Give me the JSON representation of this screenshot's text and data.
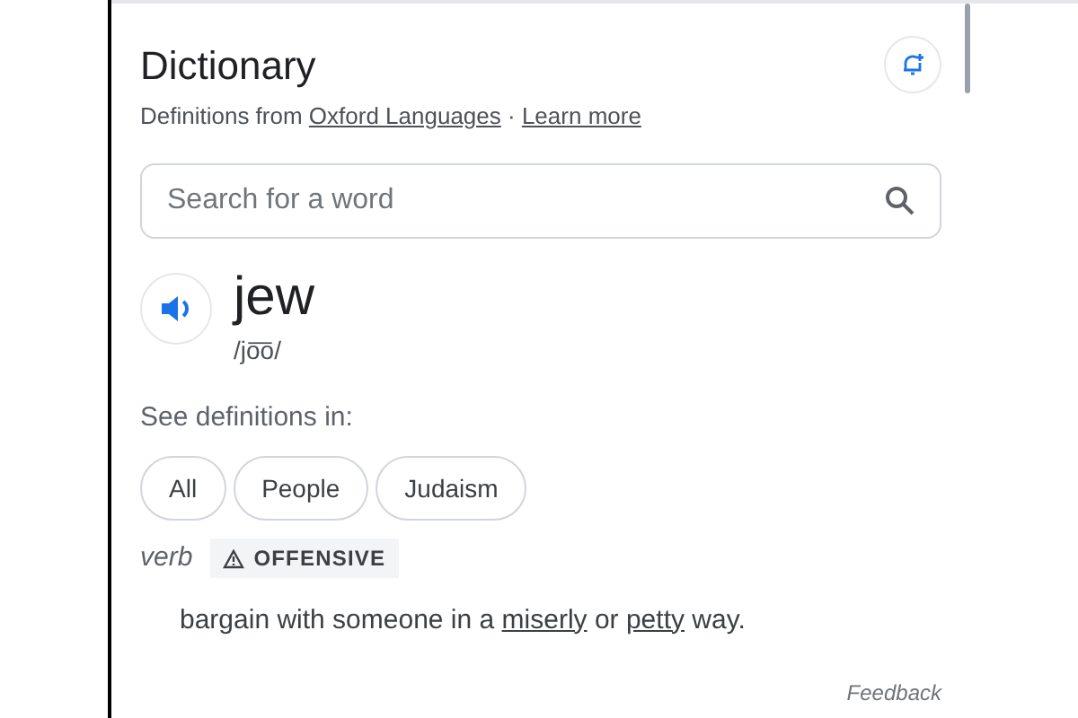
{
  "title": "Dictionary",
  "source": [
    {
      "text": "Definitions from ",
      "link": false
    },
    {
      "text": "Oxford Languages",
      "link": true
    },
    {
      "text": " · ",
      "link": false
    },
    {
      "text": "Learn more",
      "link": true
    }
  ],
  "search": {
    "placeholder": "Search for a word"
  },
  "entry": {
    "word": "jew",
    "pronunciation": "/jo͞o/"
  },
  "see_definitions_label": "See definitions in:",
  "chips": [
    "All",
    "People",
    "Judaism"
  ],
  "sense": {
    "part_of_speech": "verb",
    "tag": "OFFENSIVE"
  },
  "definition": [
    {
      "text": "bargain with someone in a ",
      "link": false
    },
    {
      "text": "miserly",
      "link": true
    },
    {
      "text": " or ",
      "link": false
    },
    {
      "text": "petty",
      "link": true
    },
    {
      "text": " way.",
      "link": false
    }
  ],
  "feedback": "Feedback"
}
